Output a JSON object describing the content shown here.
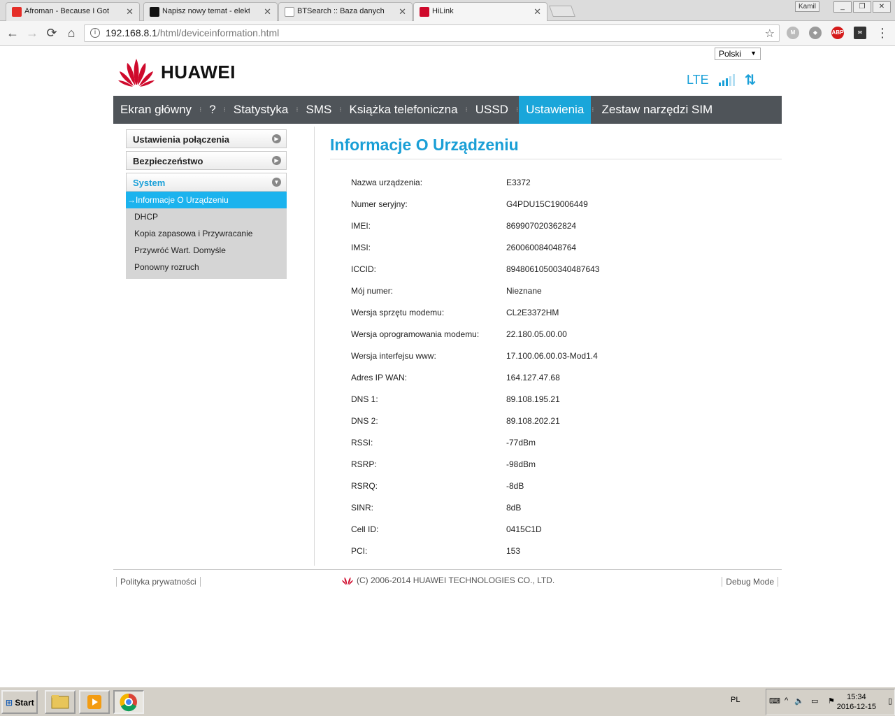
{
  "browser": {
    "tabs": [
      {
        "title": "Afroman - Because I Got",
        "fav_color": "#e52d27",
        "fav_icon": "youtube-icon"
      },
      {
        "title": "Napisz nowy temat - elektro",
        "fav_color": "#111111",
        "fav_icon": "elektroda-icon"
      },
      {
        "title": "BTSearch :: Baza danych o",
        "fav_color": "#ffffff",
        "fav_icon": "antenna-icon"
      },
      {
        "title": "HiLink",
        "fav_color": "#cf0a2c",
        "fav_icon": "huawei-icon"
      }
    ],
    "window_user": "Kamil",
    "url_host": "192.168.8.1",
    "url_path": "/html/deviceinformation.html"
  },
  "header": {
    "language": "Polski",
    "brand": "HUAWEI",
    "network": "LTE",
    "signal_level": 3,
    "signal_max": 5,
    "transfer_glyph": "⇅"
  },
  "nav": [
    {
      "label": "Ekran główny",
      "active": false
    },
    {
      "label": "?",
      "active": false
    },
    {
      "label": "Statystyka",
      "active": false
    },
    {
      "label": "SMS",
      "active": false
    },
    {
      "label": "Książka telefoniczna",
      "active": false
    },
    {
      "label": "USSD",
      "active": false
    },
    {
      "label": "Ustawienia",
      "active": true
    },
    {
      "label": "Zestaw narzędzi SIM",
      "active": false
    }
  ],
  "sidebar": {
    "sections": [
      {
        "label": "Ustawienia połączenia"
      },
      {
        "label": "Bezpieczeństwo"
      },
      {
        "label": "System"
      }
    ],
    "system_items": [
      {
        "label": "Informacje O Urządzeniu",
        "selected": true
      },
      {
        "label": "DHCP",
        "selected": false
      },
      {
        "label": "Kopia zapasowa i Przywracanie",
        "selected": false
      },
      {
        "label": "Przywróć Wart. Domyśle",
        "selected": false
      },
      {
        "label": "Ponowny rozruch",
        "selected": false
      }
    ]
  },
  "content": {
    "title": "Informacje O Urządzeniu",
    "rows": [
      {
        "label": "Nazwa urządzenia:",
        "value": "E3372"
      },
      {
        "label": "Numer seryjny:",
        "value": "G4PDU15C19006449"
      },
      {
        "label": "IMEI:",
        "value": "869907020362824"
      },
      {
        "label": "IMSI:",
        "value": "260060084048764"
      },
      {
        "label": "ICCID:",
        "value": "89480610500340487643"
      },
      {
        "label": "Mój numer:",
        "value": "Nieznane"
      },
      {
        "label": "Wersja sprzętu modemu:",
        "value": "CL2E3372HM"
      },
      {
        "label": "Wersja oprogramowania modemu:",
        "value": "22.180.05.00.00"
      },
      {
        "label": "Wersja interfejsu www:",
        "value": "17.100.06.00.03-Mod1.4"
      },
      {
        "label": "Adres IP WAN:",
        "value": "164.127.47.68"
      },
      {
        "label": "DNS 1:",
        "value": "89.108.195.21"
      },
      {
        "label": "DNS 2:",
        "value": "89.108.202.21"
      },
      {
        "label": "RSSI:",
        "value": "-77dBm"
      },
      {
        "label": "RSRP:",
        "value": "-98dBm"
      },
      {
        "label": "RSRQ:",
        "value": "-8dB"
      },
      {
        "label": "SINR:",
        "value": "8dB"
      },
      {
        "label": "Cell ID:",
        "value": "0415C1D"
      },
      {
        "label": "PCI:",
        "value": "153"
      }
    ]
  },
  "footer": {
    "privacy": "Polityka prywatności",
    "copyright": "(C) 2006-2014 HUAWEI TECHNOLOGIES CO., LTD.",
    "debug": "Debug Mode"
  },
  "taskbar": {
    "start": "Start",
    "lang": "PL",
    "time": "15:34",
    "date": "2016-12-15"
  },
  "colors": {
    "accent": "#1aa6da",
    "nav_bg": "#4f5459",
    "huawei_red": "#cf0a2c"
  }
}
